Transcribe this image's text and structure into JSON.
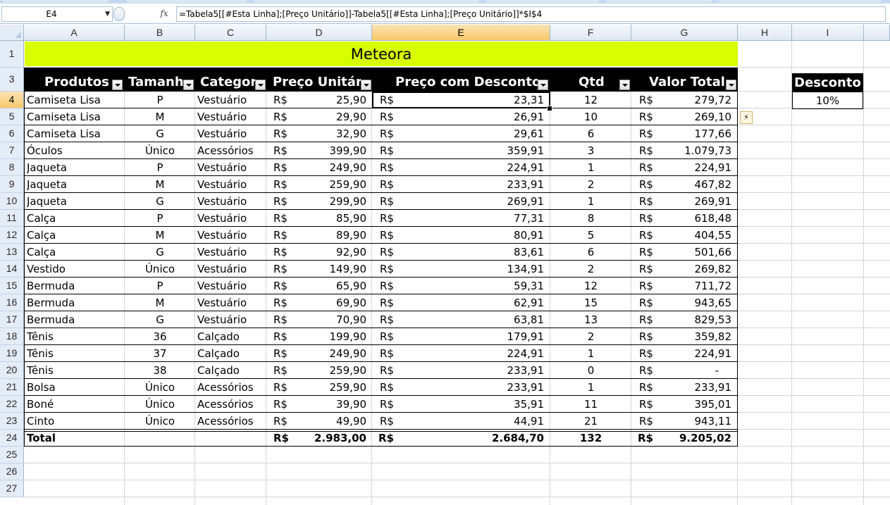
{
  "formula_bar": {
    "name_box": "E4",
    "fx_label": "fx",
    "formula": "=Tabela5[[#Esta Linha];[Preço Unitário]]-Tabela5[[#Esta Linha];[Preço Unitário]]*$I$4"
  },
  "columns": [
    "A",
    "B",
    "C",
    "D",
    "E",
    "F",
    "G",
    "H",
    "I"
  ],
  "selected_column": "E",
  "row_numbers": [
    "1",
    "3",
    "4",
    "5",
    "6",
    "7",
    "8",
    "9",
    "10",
    "11",
    "12",
    "13",
    "14",
    "15",
    "16",
    "17",
    "18",
    "19",
    "20",
    "21",
    "22",
    "23",
    "24",
    "25",
    "26",
    "27"
  ],
  "selected_row": "4",
  "sheet": {
    "title": "Meteora",
    "headers": [
      "Produtos",
      "Tamanho",
      "Categoria",
      "Preço Unitário",
      "Preço com Desconto",
      "Qtd",
      "Valor Total"
    ],
    "currency": "R$",
    "rows": [
      [
        "Camiseta Lisa",
        "P",
        "Vestuário",
        "25,90",
        "23,31",
        "12",
        "279,72"
      ],
      [
        "Camiseta Lisa",
        "M",
        "Vestuário",
        "29,90",
        "26,91",
        "10",
        "269,10"
      ],
      [
        "Camiseta Lisa",
        "G",
        "Vestuário",
        "32,90",
        "29,61",
        "6",
        "177,66"
      ],
      [
        "Óculos",
        "Único",
        "Acessórios",
        "399,90",
        "359,91",
        "3",
        "1.079,73"
      ],
      [
        "Jaqueta",
        "P",
        "Vestuário",
        "249,90",
        "224,91",
        "1",
        "224,91"
      ],
      [
        "Jaqueta",
        "M",
        "Vestuário",
        "259,90",
        "233,91",
        "2",
        "467,82"
      ],
      [
        "Jaqueta",
        "G",
        "Vestuário",
        "299,90",
        "269,91",
        "1",
        "269,91"
      ],
      [
        "Calça",
        "P",
        "Vestuário",
        "85,90",
        "77,31",
        "8",
        "618,48"
      ],
      [
        "Calça",
        "M",
        "Vestuário",
        "89,90",
        "80,91",
        "5",
        "404,55"
      ],
      [
        "Calça",
        "G",
        "Vestuário",
        "92,90",
        "83,61",
        "6",
        "501,66"
      ],
      [
        "Vestido",
        "Único",
        "Vestuário",
        "149,90",
        "134,91",
        "2",
        "269,82"
      ],
      [
        "Bermuda",
        "P",
        "Vestuário",
        "65,90",
        "59,31",
        "12",
        "711,72"
      ],
      [
        "Bermuda",
        "M",
        "Vestuário",
        "69,90",
        "62,91",
        "15",
        "943,65"
      ],
      [
        "Bermuda",
        "G",
        "Vestuário",
        "70,90",
        "63,81",
        "13",
        "829,53"
      ],
      [
        "Tênis",
        "36",
        "Calçado",
        "199,90",
        "179,91",
        "2",
        "359,82"
      ],
      [
        "Tênis",
        "37",
        "Calçado",
        "249,90",
        "224,91",
        "1",
        "224,91"
      ],
      [
        "Tênis",
        "38",
        "Calçado",
        "259,90",
        "233,91",
        "0",
        "-"
      ],
      [
        "Bolsa",
        "Único",
        "Acessórios",
        "259,90",
        "233,91",
        "1",
        "233,91"
      ],
      [
        "Boné",
        "Único",
        "Acessórios",
        "39,90",
        "35,91",
        "11",
        "395,01"
      ],
      [
        "Cinto",
        "Único",
        "Acessórios",
        "49,90",
        "44,91",
        "21",
        "943,11"
      ]
    ],
    "total": {
      "label": "Total",
      "preco_unitario": "2.983,00",
      "preco_desconto": "2.684,70",
      "qtd": "132",
      "valor_total": "9.205,02"
    },
    "discount": {
      "label": "Desconto",
      "value": "10%"
    }
  },
  "colors": {
    "title_fill": "#d8ff00",
    "header_fill": "#000000",
    "selected_header": "#f7c86a"
  }
}
